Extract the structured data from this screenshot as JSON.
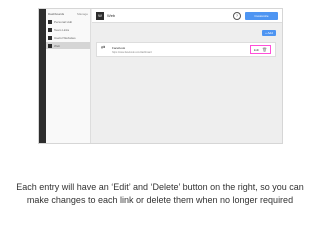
{
  "sidebar": {
    "title": "Dashboards",
    "manage_label": "Manage",
    "items": [
      {
        "label": "Personal Hub"
      },
      {
        "label": "Team Links"
      },
      {
        "label": "Useful Websites"
      },
      {
        "label": "Web"
      }
    ]
  },
  "topbar": {
    "brand_icon": "W",
    "title": "Web",
    "help_icon": "?",
    "customize_label": "Customize"
  },
  "toolbar": {
    "add_label": "+ Add"
  },
  "links": [
    {
      "icon": "⇄",
      "name": "Facebook",
      "url": "https://www.facebook.com/dashboard",
      "edit_label": "Edit",
      "delete_icon": "🗑"
    }
  ],
  "caption": "Each entry will have an ‘Edit’ and ‘Delete’ button on the right, so you can make changes to each link or delete them when no longer required",
  "colors": {
    "accent": "#4e95f2",
    "highlight": "#ff4fd8"
  }
}
